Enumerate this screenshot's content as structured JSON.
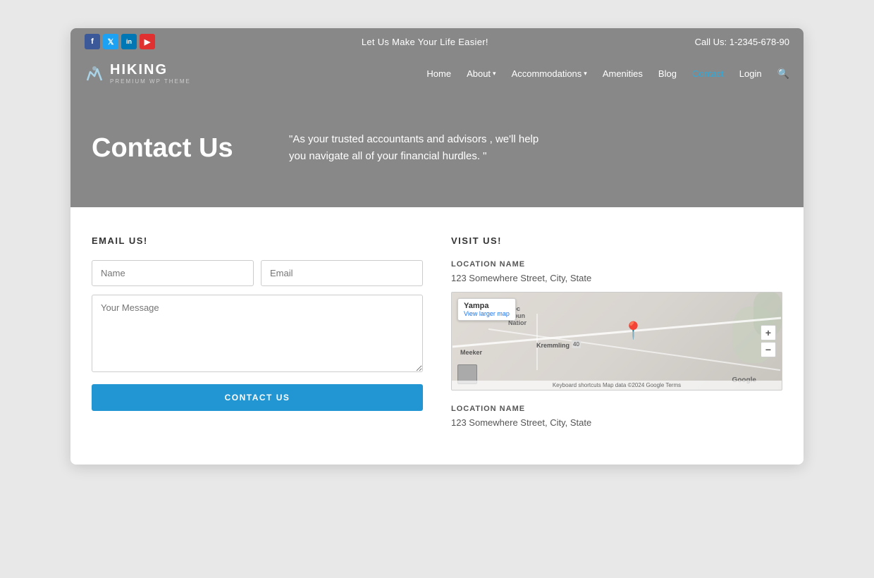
{
  "topbar": {
    "tagline": "Let Us Make Your Life Easier!",
    "phone_label": "Call Us: 1-2345-678-90",
    "social": [
      {
        "name": "facebook",
        "label": "f"
      },
      {
        "name": "twitter",
        "label": "t"
      },
      {
        "name": "linkedin",
        "label": "in"
      },
      {
        "name": "youtube",
        "label": "▶"
      }
    ]
  },
  "header": {
    "logo_text": "HIKING",
    "logo_sub": "PREMIUM WP THEME",
    "nav_items": [
      {
        "label": "Home",
        "active": false,
        "has_arrow": false
      },
      {
        "label": "About",
        "active": false,
        "has_arrow": true
      },
      {
        "label": "Accommodations",
        "active": false,
        "has_arrow": true
      },
      {
        "label": "Amenities",
        "active": false,
        "has_arrow": false
      },
      {
        "label": "Blog",
        "active": false,
        "has_arrow": false
      },
      {
        "label": "Contact",
        "active": true,
        "has_arrow": false
      },
      {
        "label": "Login",
        "active": false,
        "has_arrow": false
      }
    ]
  },
  "hero": {
    "title": "Contact Us",
    "quote": "\"As your trusted accountants and advisors , we'll help you navigate all of your financial hurdles. \""
  },
  "email_section": {
    "title": "EMAIL US!",
    "name_placeholder": "Name",
    "email_placeholder": "Email",
    "message_placeholder": "Your Message",
    "button_label": "CONTACT US"
  },
  "visit_section": {
    "title": "VISIT US!",
    "locations": [
      {
        "label": "LOCATION NAME",
        "address": "123 Somewhere Street, City, State"
      },
      {
        "label": "LOCATION NAME",
        "address": "123 Somewhere Street, City, State"
      }
    ],
    "map": {
      "place_name": "Yampa",
      "view_larger": "View larger map",
      "zoom_in": "+",
      "zoom_out": "−",
      "footer_text": "Keyboard shortcuts   Map data ©2024 Google   Terms"
    }
  }
}
